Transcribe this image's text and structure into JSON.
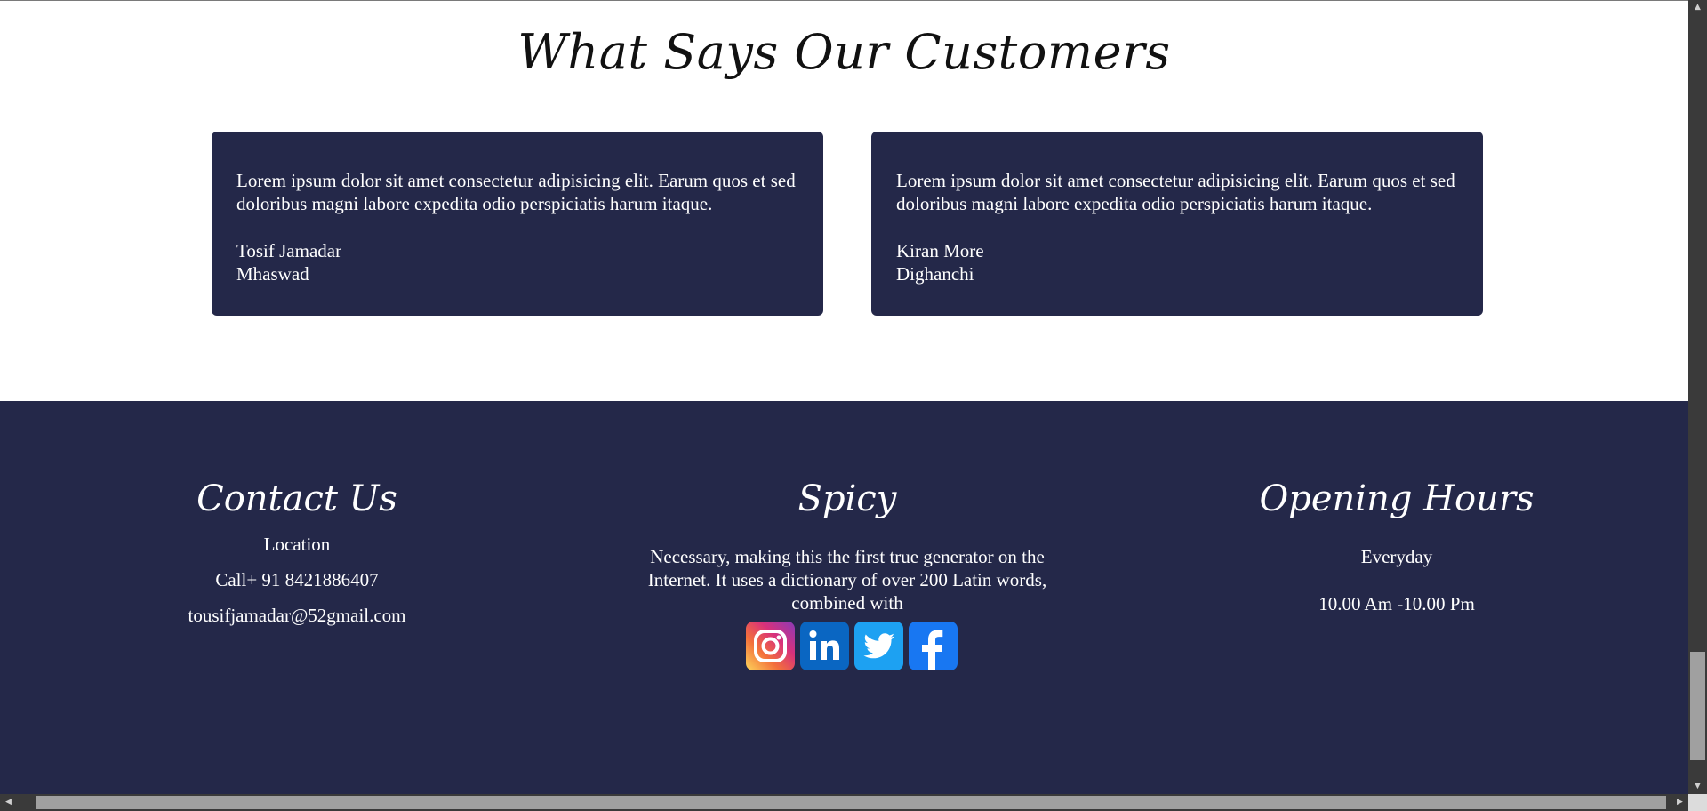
{
  "testimonials": {
    "title": "What Says Our Customers",
    "reviews": [
      {
        "text": "Lorem ipsum dolor sit amet consectetur adipisicing elit. Earum quos et sed doloribus magni labore expedita odio perspiciatis harum itaque.",
        "name": "Tosif Jamadar",
        "place": "Mhaswad"
      },
      {
        "text": "Lorem ipsum dolor sit amet consectetur adipisicing elit. Earum quos et sed doloribus magni labore expedita odio perspiciatis harum itaque.",
        "name": "Kiran More",
        "place": "Dighanchi"
      }
    ]
  },
  "footer": {
    "contact": {
      "heading": "Contact Us",
      "location": "Location",
      "phone": "Call+ 91 8421886407",
      "email": "tousifjamadar@52gmail.com"
    },
    "spicy": {
      "heading": "Spicy",
      "text": "Necessary, making this the first true generator on the Internet. It uses a dictionary of over 200 Latin words, combined with",
      "social": [
        {
          "icon": "instagram-icon",
          "color": "#e1306c"
        },
        {
          "icon": "linkedin-icon",
          "color": "#0a66c2"
        },
        {
          "icon": "twitter-icon",
          "color": "#1da1f2"
        },
        {
          "icon": "facebook-icon",
          "color": "#1877f2"
        }
      ]
    },
    "hours": {
      "heading": "Opening Hours",
      "day": "Everyday",
      "time": "10.00 Am -10.00 Pm"
    }
  },
  "colors": {
    "navy": "#242849",
    "white": "#ffffff"
  }
}
